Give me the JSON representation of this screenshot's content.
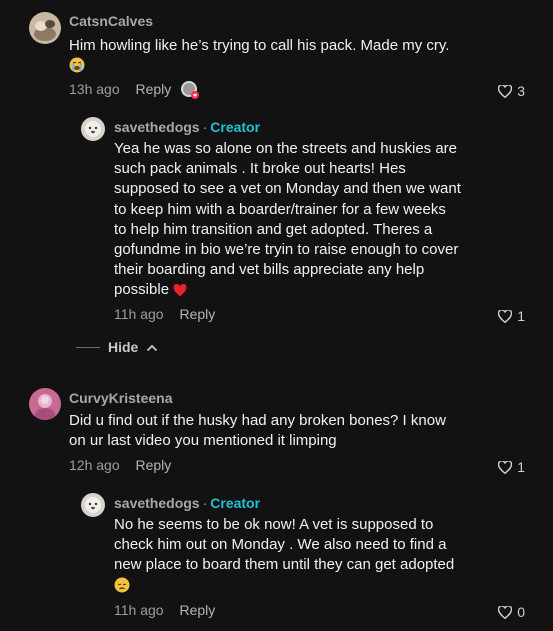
{
  "comments": [
    {
      "username": "CatsnCalves",
      "text": "Him howling like he’s trying to call his pack. Made my cry.",
      "emoji": "crying-face",
      "time": "13h ago",
      "reply_label": "Reply",
      "likes": "3"
    },
    {
      "username": "savethedogs",
      "badge_sep": "·",
      "badge": "Creator",
      "lines": [
        "Yea he was so alone on the streets and huskies are",
        "such pack animals . It broke out hearts! Hes",
        "supposed to see a vet on Monday and then we want",
        "to keep him with a boarder/trainer for a few weeks",
        "to help him transition and get adopted. Theres a",
        "gofundme in bio we’re tryin to raise enough to cover",
        "their boarding and vet bills appreciate any help",
        "possible"
      ],
      "emoji": "red-heart",
      "time": "11h ago",
      "reply_label": "Reply",
      "likes": "1"
    },
    {
      "username": "CurvyKristeena",
      "lines": [
        "Did u find out if the husky had any broken bones? I know",
        "on ur last video you mentioned it limping"
      ],
      "time": "12h ago",
      "reply_label": "Reply",
      "likes": "1"
    },
    {
      "username": "savethedogs",
      "badge_sep": "·",
      "badge": "Creator",
      "lines": [
        "No he seems to be ok now! A vet is supposed to",
        "check him out on Monday . We also need to find a",
        "new place to board them until they can get adopted"
      ],
      "emoji": "disappointed-face",
      "time": "11h ago",
      "reply_label": "Reply",
      "likes": "0"
    }
  ],
  "hide_label": "Hide",
  "colors": {
    "background": "#121212",
    "creator_badge": "#20c1d8",
    "heart": "#fe2c55"
  }
}
